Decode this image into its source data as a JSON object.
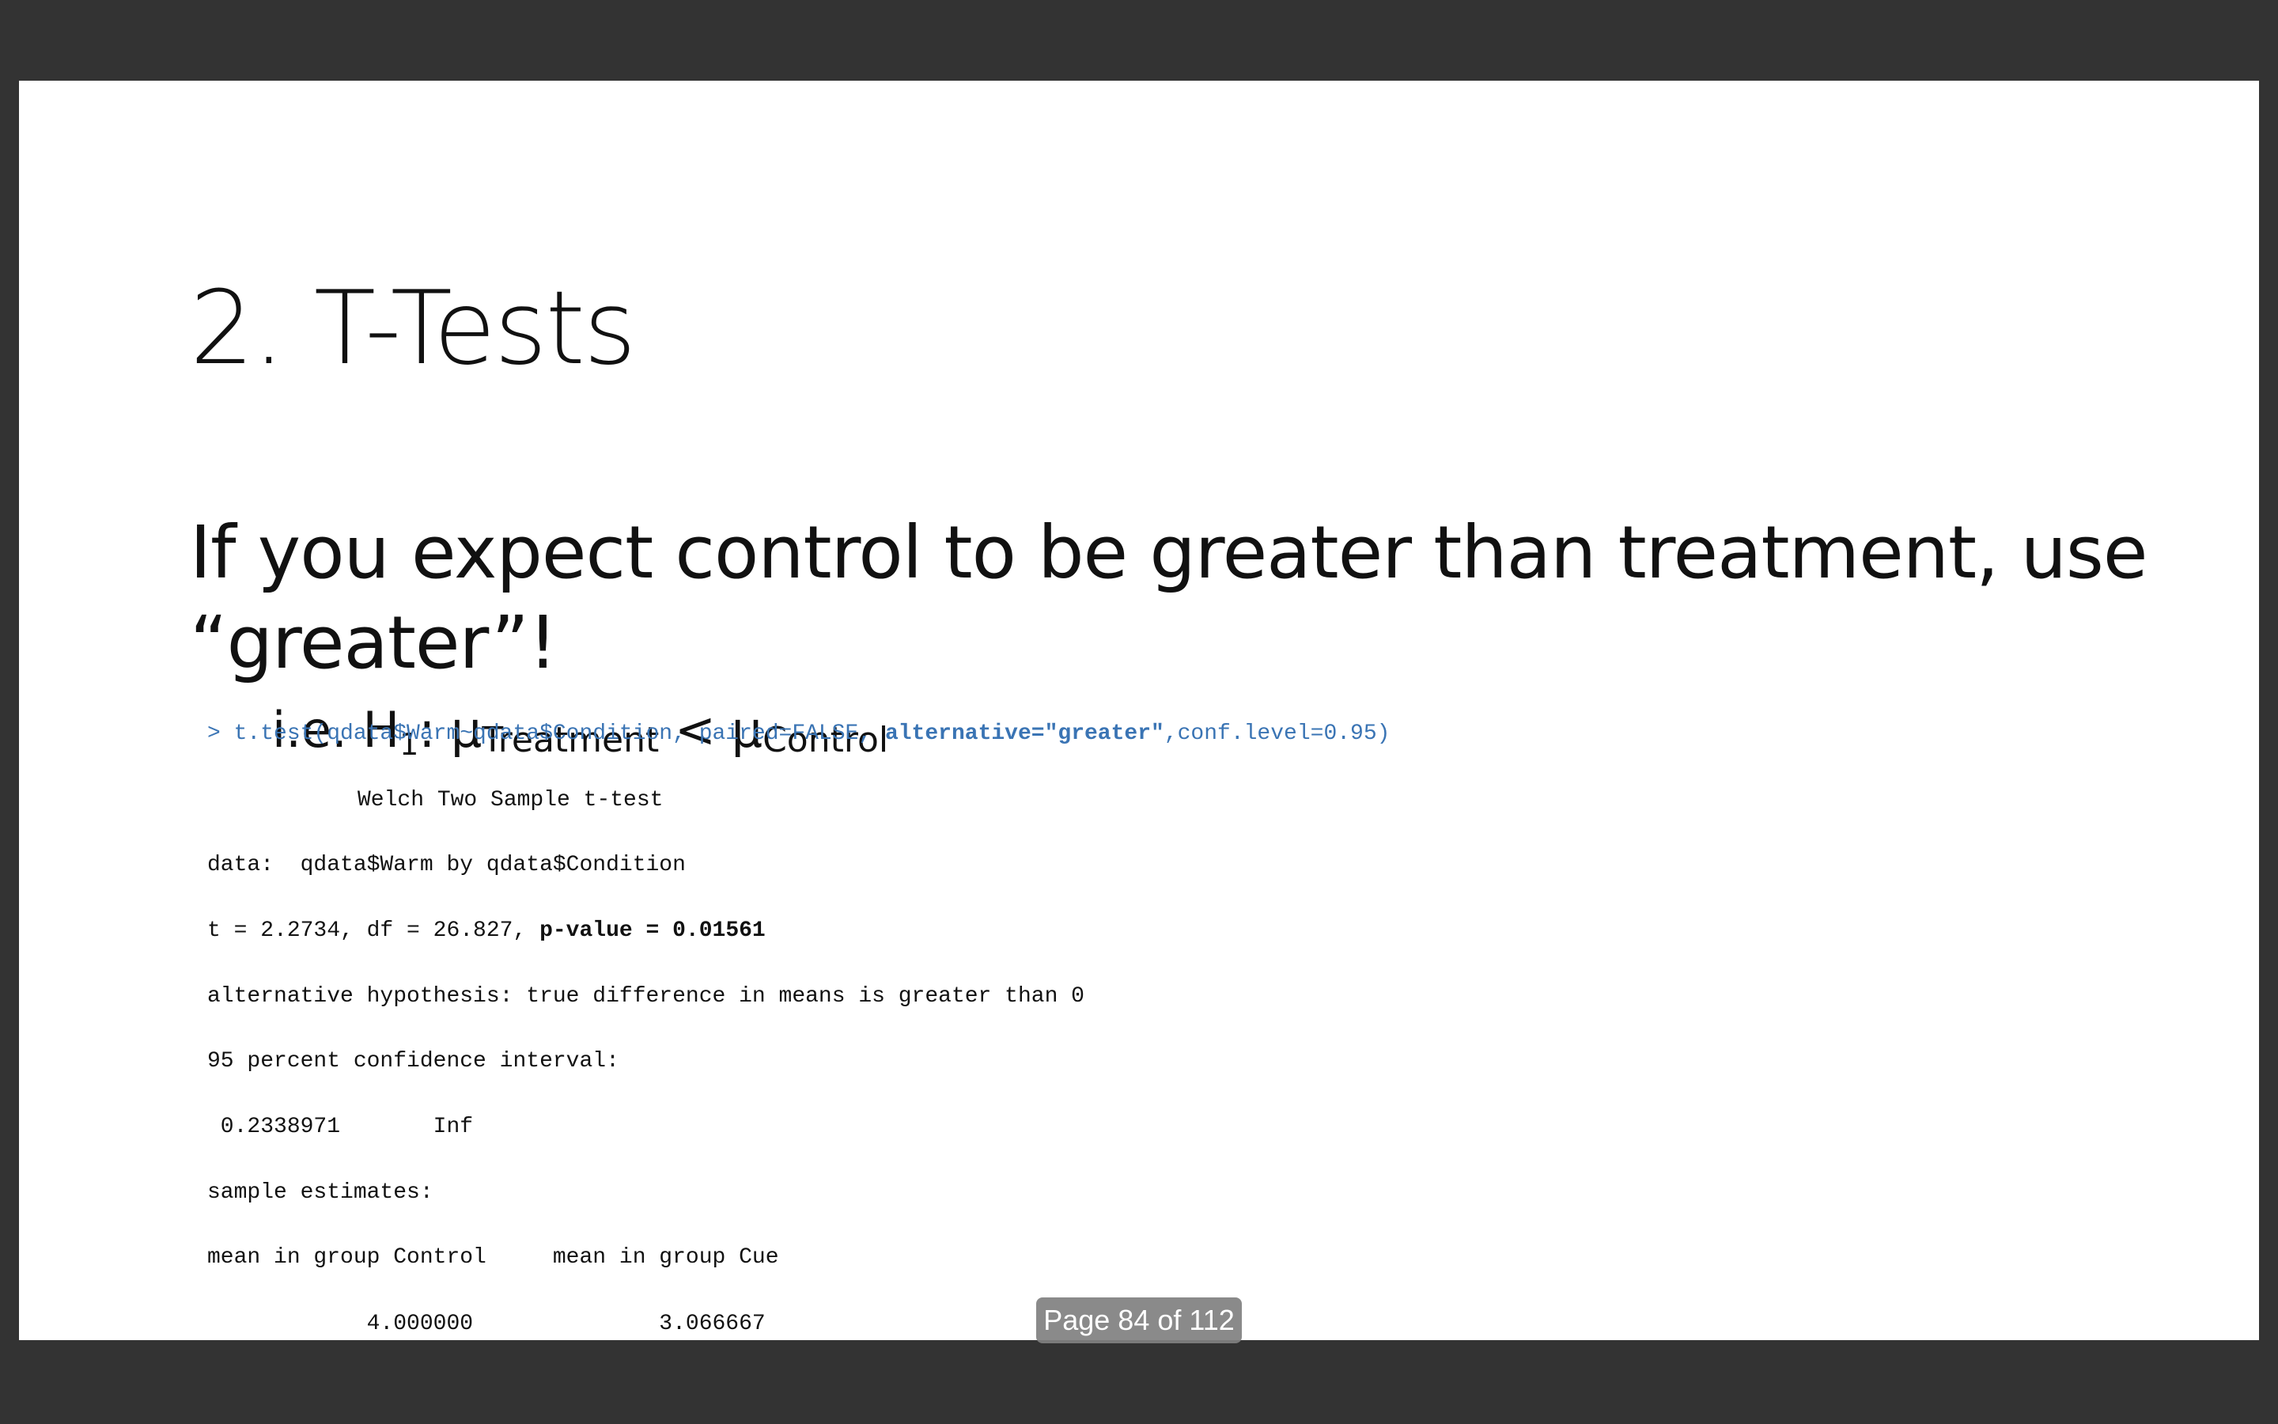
{
  "slide": {
    "title": "2. T-Tests",
    "lead": "If you expect control to be greater than treatment, use “greater”!",
    "hypothesis": {
      "prefix": "i.e. H",
      "h_sub": "1",
      "mid": ": μ",
      "treatment_sub": "Treatment",
      "relation": " < μ",
      "control_sub": "Control"
    },
    "command": {
      "prompt": "> t.test(qdata$Warm~qdata$Condition, paired=FALSE, ",
      "highlight": "alternative=\"greater\"",
      "suffix": ",conf.level=0.95)"
    },
    "output": {
      "test_name": "Welch Two Sample t-test",
      "data_line": "data:  qdata$Warm by qdata$Condition",
      "stats_prefix": "t = 2.2734, df = 26.827, ",
      "p_value": "p-value = 0.01561",
      "alternative": "alternative hypothesis: true difference in means is greater than 0",
      "ci_label": "95 percent confidence interval:",
      "ci_values": " 0.2338971       Inf",
      "estimates_label": "sample estimates:",
      "estimates_header": "mean in group Control     mean in group Cue",
      "estimates_values": "            4.000000              3.066667"
    }
  },
  "viewer": {
    "page_indicator": "Page 84 of 112"
  }
}
